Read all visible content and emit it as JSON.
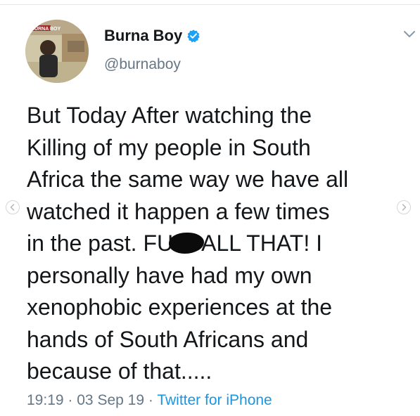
{
  "tweet": {
    "author": {
      "display_name": "Burna Boy",
      "handle": "@burnaboy",
      "verified": true,
      "avatar_text": "BURNA BOY"
    },
    "text_lines": [
      "But Today After watching the",
      "Killing of my people in South",
      "Africa the same way we have all",
      "watched it happen a few times",
      "in the past. FU",
      "ALL THAT!  I",
      "personally have had my own",
      "xenophobic experiences at the",
      "hands of South Africans and",
      "because of that....."
    ],
    "time": "19:19",
    "separator": "·",
    "date": "03 Sep 19",
    "source": "Twitter for iPhone"
  },
  "colors": {
    "text": "#14171a",
    "secondary": "#657786",
    "link": "#1b95e0",
    "verified": "#1da1f2"
  },
  "icons": {
    "verified": "verified-badge-icon",
    "menu": "chevron-down-icon",
    "carousel_prev": "chevron-left-icon",
    "carousel_next": "chevron-right-icon"
  }
}
